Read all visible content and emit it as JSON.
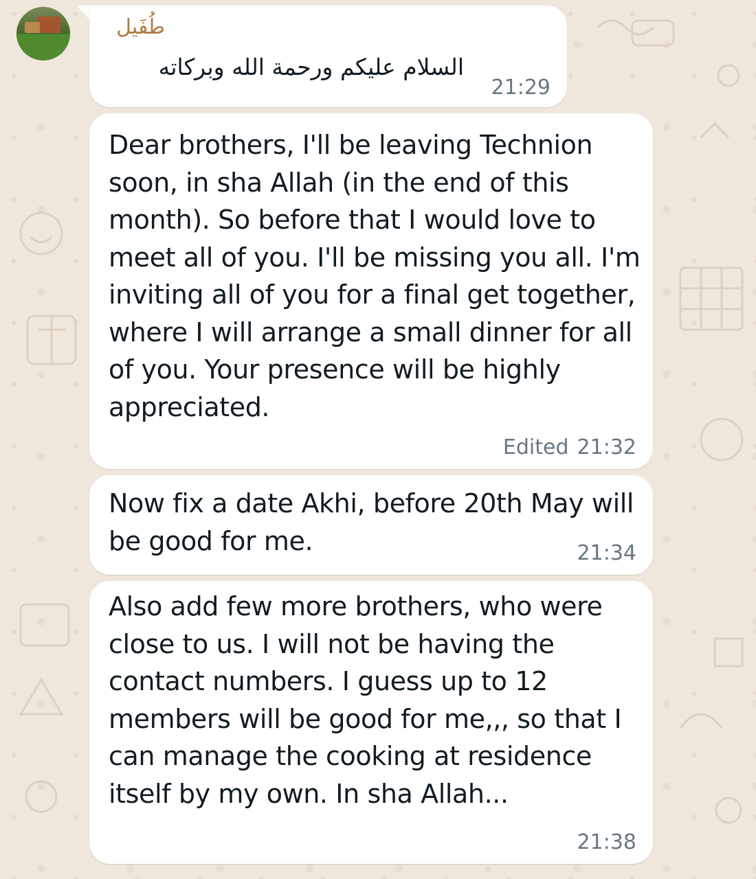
{
  "chat": {
    "sender_name": "طُفَيل",
    "avatar_label": "avatar",
    "messages": [
      {
        "text": "السلام عليكم ورحمة الله وبركاته",
        "time": "21:29",
        "edited_label": ""
      },
      {
        "text": "Dear brothers, I'll be leaving Technion soon, in sha Allah (in the end of this month). So before that I would love to meet all of you. I'll be missing you all. I'm inviting all of you for a final get together, where I will arrange a small dinner for all of you. Your presence will be highly appreciated.",
        "time": "21:32",
        "edited_label": "Edited"
      },
      {
        "text": "Now fix a date Akhi, before 20th May will be good for me.",
        "time": "21:34",
        "edited_label": ""
      },
      {
        "text": "Also add few more brothers, who were close to us. I will not be having the contact numbers. I guess up to 12 members will be good for me,,, so that I can manage the cooking at residence itself by my own. In sha Allah...",
        "time": "21:38",
        "edited_label": ""
      }
    ]
  },
  "theme": {
    "wallpaper": "#efe7dc",
    "bubble": "#ffffff",
    "sender_color": "#b07a3e",
    "time_color": "#667781",
    "text_color": "#111b21"
  }
}
